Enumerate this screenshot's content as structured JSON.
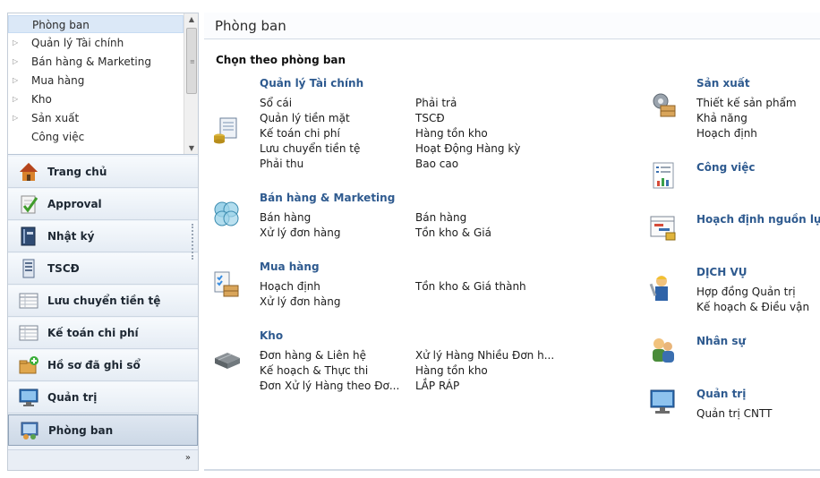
{
  "tree": {
    "items": [
      {
        "label": "Phòng ban",
        "selected": true,
        "expander": ""
      },
      {
        "label": "Quản lý Tài chính",
        "selected": false,
        "expander": "▷"
      },
      {
        "label": "Bán hàng & Marketing",
        "selected": false,
        "expander": "▷"
      },
      {
        "label": "Mua hàng",
        "selected": false,
        "expander": "▷"
      },
      {
        "label": "Kho",
        "selected": false,
        "expander": "▷"
      },
      {
        "label": "Sản xuất",
        "selected": false,
        "expander": "▷"
      },
      {
        "label": "Công việc",
        "selected": false,
        "expander": ""
      }
    ]
  },
  "nav": {
    "buttons": [
      {
        "label": "Trang chủ",
        "icon": "home-icon"
      },
      {
        "label": "Approval",
        "icon": "approval-icon"
      },
      {
        "label": "Nhật ký",
        "icon": "journal-icon"
      },
      {
        "label": "TSCĐ",
        "icon": "asset-icon"
      },
      {
        "label": "Lưu chuyển tiền tệ",
        "icon": "ledger-icon"
      },
      {
        "label": "Kế toán chi phí",
        "icon": "ledger-icon"
      },
      {
        "label": "Hồ sơ đã ghi sổ",
        "icon": "posted-records-icon"
      },
      {
        "label": "Quản trị",
        "icon": "admin-icon"
      },
      {
        "label": "Phòng ban",
        "icon": "department-icon",
        "active": true
      }
    ],
    "more_glyph": "»"
  },
  "main": {
    "title": "Phòng ban",
    "section_title": "Chọn theo phòng ban",
    "groups": {
      "finance": {
        "title": "Quản lý Tài chính",
        "col1": [
          "Sổ cái",
          "Quản lý tiền mặt",
          "Kế toán chi phí",
          "Lưu chuyển tiền tệ",
          "Phải thu"
        ],
        "col2": [
          "Phải trả",
          "TSCĐ",
          "Hàng tồn kho",
          "Hoạt Động Hàng kỳ",
          "Bao cao"
        ]
      },
      "sales": {
        "title": "Bán hàng & Marketing",
        "col1": [
          "Bán hàng",
          "Xử lý đơn hàng"
        ],
        "col2": [
          "Bán hàng",
          "Tồn kho & Giá"
        ]
      },
      "purchase": {
        "title": "Mua hàng",
        "col1": [
          "Hoạch định",
          "Xử lý đơn hàng"
        ],
        "col2": [
          "Tồn kho & Giá thành"
        ]
      },
      "warehouse": {
        "title": "Kho",
        "col1": [
          "Đơn hàng & Liên hệ",
          "Kế hoạch & Thực thi",
          "Đơn Xử lý Hàng theo Đơ..."
        ],
        "col2": [
          "Xử lý Hàng Nhiều Đơn h...",
          "Hàng tồn kho",
          "LẮP RÁP"
        ]
      },
      "production": {
        "title": "Sản xuất",
        "col1": [
          "Thiết kế sản phẩm",
          "Khả năng",
          "Hoạch định"
        ]
      },
      "jobs": {
        "title": "Công việc"
      },
      "resource_planning": {
        "title": "Hoạch định nguồn lực"
      },
      "services": {
        "title": "DỊCH VỤ",
        "col1": [
          "Hợp đồng Quản trị",
          "Kế hoạch & Điều vận"
        ]
      },
      "hr": {
        "title": "Nhân sự"
      },
      "admin": {
        "title": "Quản trị",
        "col1": [
          "Quản trị CNTT"
        ]
      }
    }
  },
  "colors": {
    "link_title": "#2e5a8f",
    "nav_bg": "#eef3f9",
    "selection": "#dbe8f7"
  }
}
